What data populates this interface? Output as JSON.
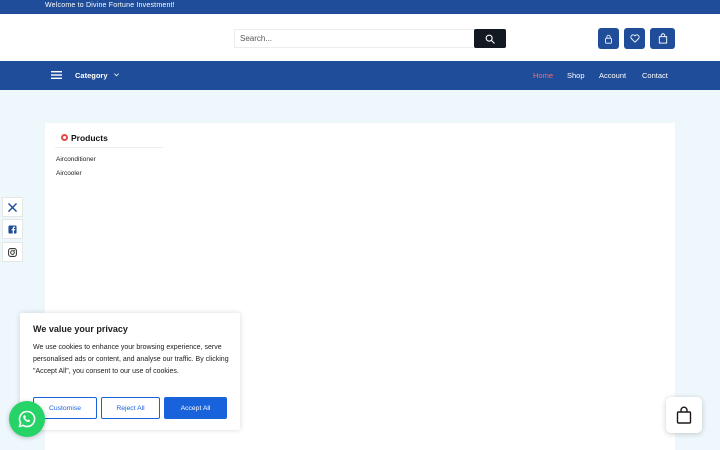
{
  "topbar": {
    "welcome": "Welcome to Divine Fortune Investment!"
  },
  "header": {
    "search_placeholder": "Search...",
    "icons": [
      "search-icon",
      "user-icon",
      "heart-icon",
      "bag-icon"
    ]
  },
  "nav": {
    "category_label": "Category",
    "links": [
      {
        "label": "Home",
        "active": true
      },
      {
        "label": "Shop",
        "active": false
      },
      {
        "label": "Account",
        "active": false
      },
      {
        "label": "Contact",
        "active": false
      }
    ]
  },
  "sidebar": {
    "title": "Products",
    "items": [
      "Airconditioner",
      "Aircooler"
    ]
  },
  "social": [
    "x-icon",
    "facebook-icon",
    "instagram-icon"
  ],
  "cookie": {
    "title": "We value your privacy",
    "text": "We use cookies to enhance your browsing experience, serve personalised ads or content, and analyse our traffic. By clicking \"Accept All\", you consent to our use of cookies.",
    "customise": "Customise",
    "reject": "Reject All",
    "accept": "Accept All"
  },
  "colors": {
    "brand": "#1f4d99",
    "active_link": "#ff6b6b",
    "cookie_button": "#1863dc",
    "whatsapp": "#25d366",
    "page_background": "#eef8fc"
  }
}
